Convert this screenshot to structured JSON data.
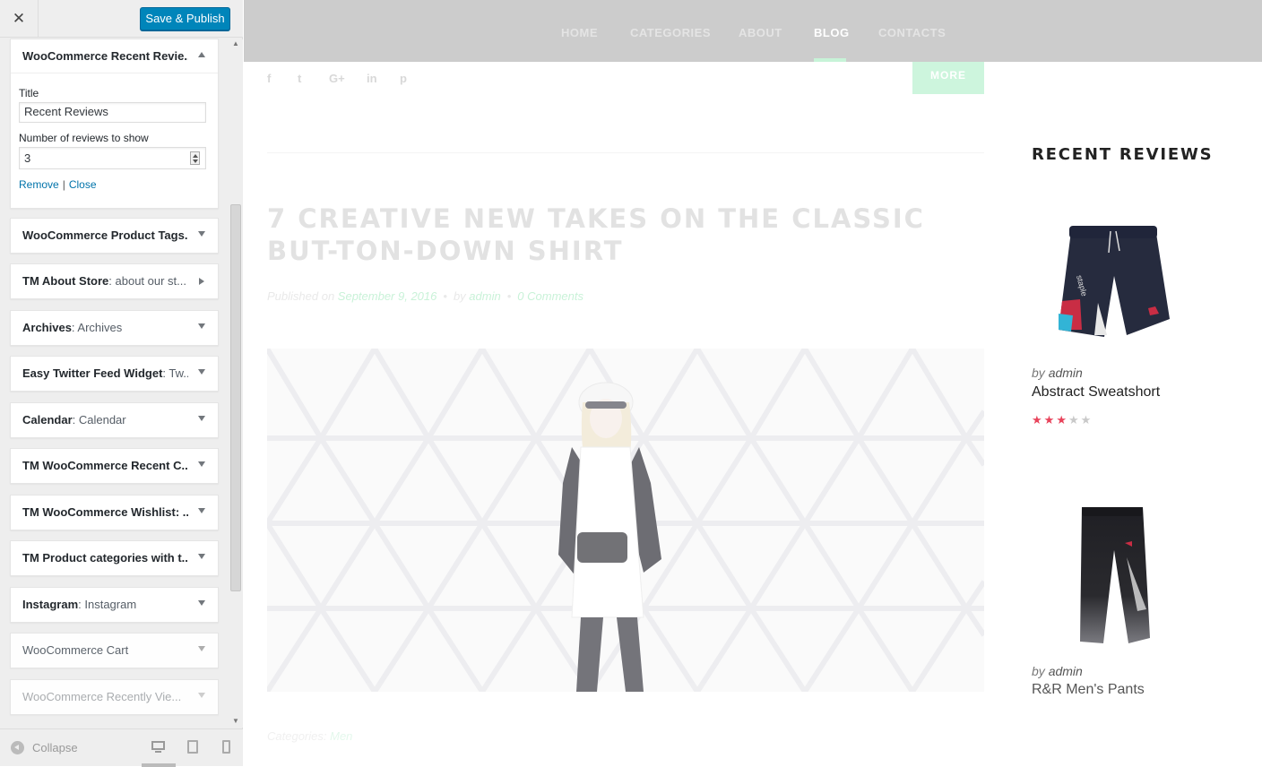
{
  "sidebar": {
    "close_label": "✕",
    "publish_label": "Save & Publish",
    "open_widget": {
      "title": "WooCommerce Recent Revie...",
      "title_label": "Title",
      "title_value": "Recent Reviews",
      "number_label": "Number of reviews to show",
      "number_value": "3",
      "remove_label": "Remove",
      "separator": "|",
      "close_label": "Close"
    },
    "widgets": [
      {
        "name": "WooCommerce Product Tags...",
        "sub": ""
      },
      {
        "name": "TM About Store",
        "sub": ": about our st..."
      },
      {
        "name": "Archives",
        "sub": ": Archives"
      },
      {
        "name": "Easy Twitter Feed Widget",
        "sub": ": Tw..."
      },
      {
        "name": "Calendar",
        "sub": ": Calendar"
      },
      {
        "name": "TM WooCommerce Recent C...",
        "sub": ""
      },
      {
        "name": "TM WooCommerce Wishlist: ...",
        "sub": ""
      },
      {
        "name": "TM Product categories with t...",
        "sub": ""
      },
      {
        "name": "Instagram",
        "sub": ": Instagram"
      },
      {
        "name": "WooCommerce Cart",
        "sub": ""
      },
      {
        "name": "WooCommerce Recently Vie...",
        "sub": ""
      }
    ],
    "footer": {
      "collapse_label": "Collapse"
    }
  },
  "preview": {
    "nav": [
      "HOME",
      "CATEGORIES",
      "ABOUT",
      "BLOG",
      "CONTACTS"
    ],
    "active_nav": "BLOG",
    "social": [
      "f",
      "t",
      "G+",
      "in",
      "p"
    ],
    "more_label": "MORE",
    "post": {
      "title": "7 CREATIVE NEW TAKES ON THE CLASSIC BUT-TON-DOWN SHIRT",
      "published_on": "Published on",
      "date": "September 9, 2016",
      "dot": "•",
      "by": "by",
      "author": "admin",
      "comments": "0 Comments",
      "categories_label": "Categories:",
      "category": "Men"
    },
    "recent_reviews": {
      "title": "RECENT REVIEWS",
      "items": [
        {
          "by": "by",
          "author": "admin",
          "name": "Abstract Sweatshort",
          "rating": 3,
          "max": 5
        },
        {
          "by": "by",
          "author": "admin",
          "name": "R&R Men's Pants"
        }
      ]
    }
  },
  "colors": {
    "publish": "#0085ba",
    "nav_bg": "#cccccc",
    "accent_green": "#cdf5dd",
    "star": "#e8435b"
  }
}
